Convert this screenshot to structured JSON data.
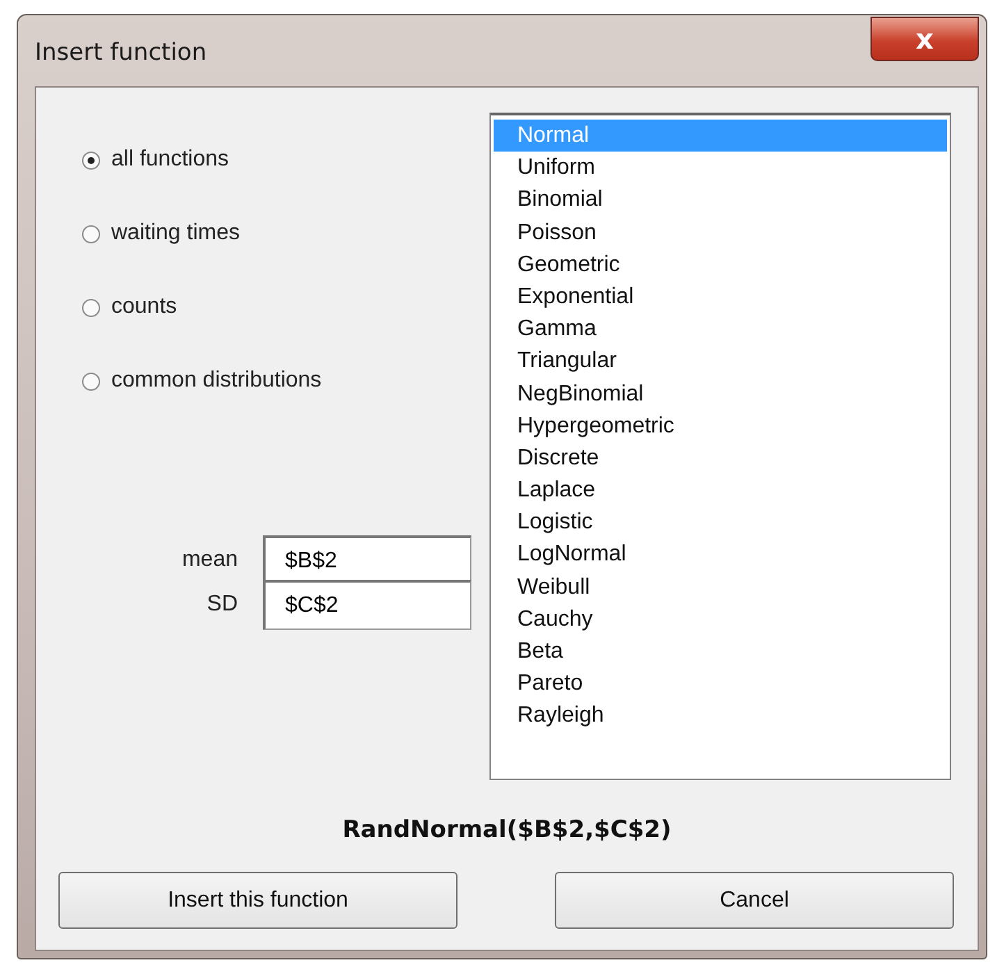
{
  "window": {
    "title": "Insert function",
    "close": "x"
  },
  "categories": [
    {
      "label": "all functions",
      "selected": true
    },
    {
      "label": "waiting times",
      "selected": false
    },
    {
      "label": "counts",
      "selected": false
    },
    {
      "label": "common distributions",
      "selected": false
    }
  ],
  "parameters": [
    {
      "label": "mean",
      "value": "$B$2"
    },
    {
      "label": "SD",
      "value": "$C$2"
    }
  ],
  "functions": [
    {
      "label": "Normal",
      "selected": true
    },
    {
      "label": "Uniform",
      "selected": false
    },
    {
      "label": "Binomial",
      "selected": false
    },
    {
      "label": "Poisson",
      "selected": false
    },
    {
      "label": "Geometric",
      "selected": false
    },
    {
      "label": "Exponential",
      "selected": false
    },
    {
      "label": "Gamma",
      "selected": false
    },
    {
      "label": "Triangular",
      "selected": false
    },
    {
      "label": "NegBinomial",
      "selected": false
    },
    {
      "label": "Hypergeometric",
      "selected": false
    },
    {
      "label": "Discrete",
      "selected": false
    },
    {
      "label": "Laplace",
      "selected": false
    },
    {
      "label": "Logistic",
      "selected": false
    },
    {
      "label": "LogNormal",
      "selected": false
    },
    {
      "label": "Weibull",
      "selected": false
    },
    {
      "label": "Cauchy",
      "selected": false
    },
    {
      "label": "Beta",
      "selected": false
    },
    {
      "label": "Pareto",
      "selected": false
    },
    {
      "label": "Rayleigh",
      "selected": false
    }
  ],
  "formula": "RandNormal($B$2,$C$2)",
  "buttons": [
    "Insert this function",
    "Cancel"
  ]
}
